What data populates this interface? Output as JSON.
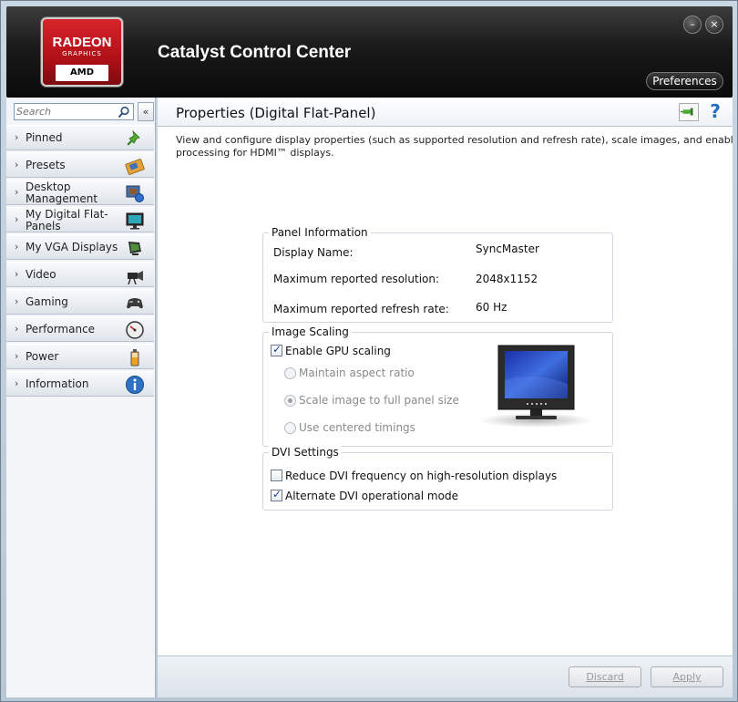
{
  "window": {
    "app_title": "Catalyst Control Center",
    "preferences_label": "Preferences",
    "minimize_glyph": "–",
    "close_glyph": "×"
  },
  "logo": {
    "line1": "RADEON",
    "line2": "GRAPHICS",
    "line3": "AMD"
  },
  "sidebar": {
    "search_placeholder": "Search",
    "collapse_glyph": "«",
    "items": [
      {
        "label": "Pinned",
        "icon": "pin-icon"
      },
      {
        "label": "Presets",
        "icon": "presets-icon"
      },
      {
        "label": "Desktop Management",
        "icon": "desktop-management-icon"
      },
      {
        "label": "My Digital Flat-Panels",
        "icon": "flat-panel-icon"
      },
      {
        "label": "My VGA Displays",
        "icon": "vga-display-icon"
      },
      {
        "label": "Video",
        "icon": "video-camera-icon"
      },
      {
        "label": "Gaming",
        "icon": "gamepad-icon"
      },
      {
        "label": "Performance",
        "icon": "gauge-icon"
      },
      {
        "label": "Power",
        "icon": "battery-icon"
      },
      {
        "label": "Information",
        "icon": "info-icon"
      }
    ]
  },
  "main": {
    "title": "Properties (Digital Flat-Panel)",
    "help_glyph": "?",
    "description_line1": "View and configure display properties (such as supported resolution and refresh rate), scale images, and enable video quality",
    "description_line2": "processing for HDMI™ displays.",
    "panel_info": {
      "title": "Panel Information",
      "rows": [
        {
          "label": "Display Name:",
          "value": "SyncMaster"
        },
        {
          "label": "Maximum reported resolution:",
          "value": "2048x1152"
        },
        {
          "label": "Maximum reported refresh rate:",
          "value": "60 Hz"
        }
      ]
    },
    "image_scaling": {
      "title": "Image Scaling",
      "enable_gpu_scaling": {
        "label": "Enable GPU scaling",
        "checked": true
      },
      "options": [
        {
          "label": "Maintain aspect ratio",
          "selected": false
        },
        {
          "label": "Scale image to full panel size",
          "selected": true
        },
        {
          "label": "Use centered timings",
          "selected": false
        }
      ]
    },
    "dvi_settings": {
      "title": "DVI Settings",
      "reduce_dvi": {
        "label": "Reduce DVI frequency on high-resolution displays",
        "checked": false
      },
      "alternate_dvi": {
        "label": "Alternate DVI operational mode",
        "checked": true
      }
    },
    "buttons": {
      "discard": "Discard",
      "apply": "Apply"
    }
  },
  "colors": {
    "accent_red": "#c8161e",
    "header_dark": "#1a1a1a",
    "help_blue": "#1e6fc0"
  }
}
